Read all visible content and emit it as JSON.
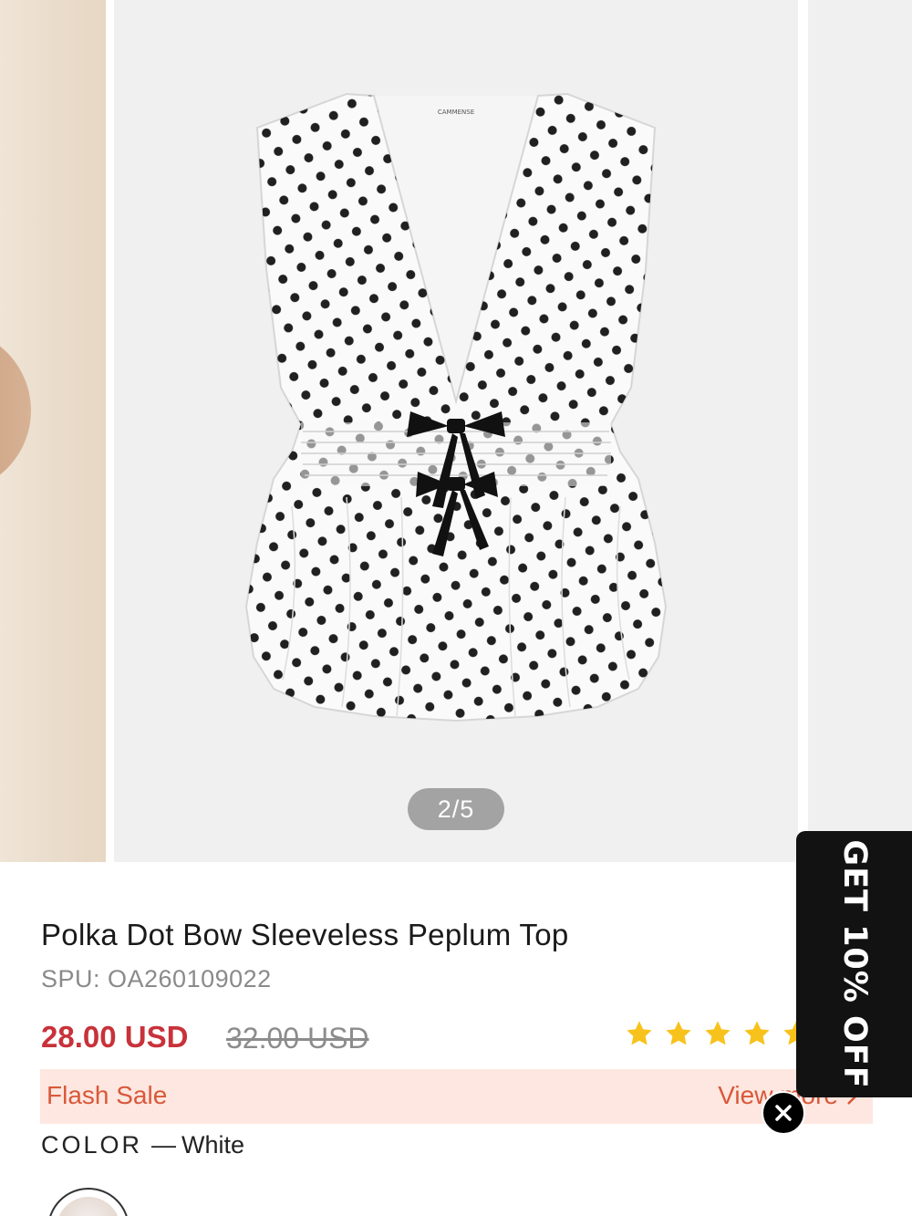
{
  "gallery": {
    "counter": "2/5",
    "current_index": 2,
    "total": 5,
    "brand_tag": "CAMMENSE"
  },
  "product": {
    "title": "Polka Dot Bow Sleeveless Peplum Top",
    "spu": "SPU: OA260109022",
    "price": "28.00 USD",
    "original_price": "32.00 USD",
    "rating_stars": 5
  },
  "flash_sale": {
    "label": "Flash Sale",
    "link": "View more"
  },
  "color": {
    "label": "COLOR",
    "separator": "—",
    "value": "White"
  },
  "discount": {
    "label": "GET 10% OFF"
  },
  "colors": {
    "price": "#c8323a",
    "flash_bg": "#fde7e0",
    "flash_text": "#d9583a",
    "star": "#f7c21b",
    "tab_bg": "#121212"
  },
  "icons": {
    "star": "star-icon",
    "chevron": "chevron-right-icon",
    "close": "close-icon"
  }
}
